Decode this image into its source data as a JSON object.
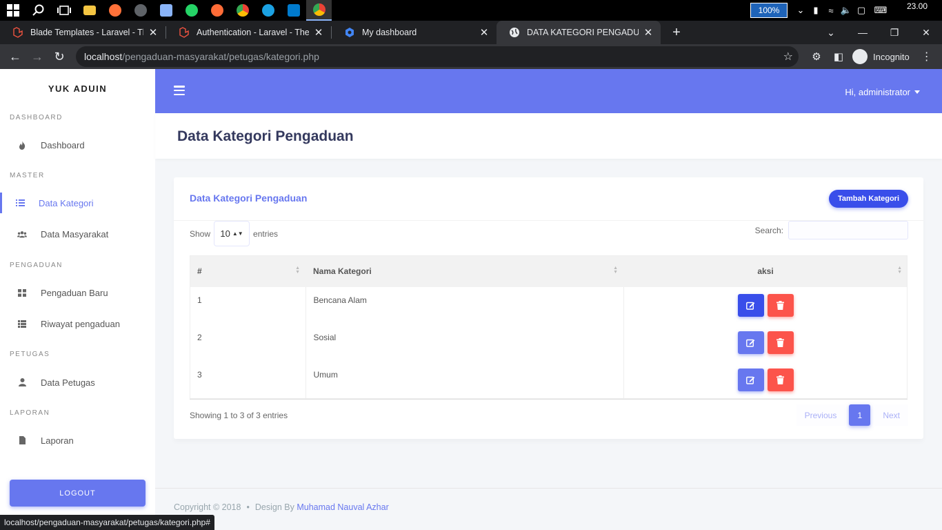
{
  "taskbar": {
    "apps": [
      {
        "icon": "windows-start-icon",
        "color": "#ffffff"
      },
      {
        "icon": "search-icon",
        "color": "#ffffff"
      },
      {
        "icon": "task-view-icon",
        "color": "#ffffff"
      },
      {
        "icon": "file-explorer-icon",
        "color": "#f4c542"
      },
      {
        "icon": "firefox-icon",
        "color": "#ff7139"
      },
      {
        "icon": "app-icon",
        "color": "#9aa0a6"
      },
      {
        "icon": "app-icon",
        "color": "#8ab4f8"
      },
      {
        "icon": "whatsapp-icon",
        "color": "#25d366"
      },
      {
        "icon": "postman-icon",
        "color": "#ff6c37"
      },
      {
        "icon": "chrome-icon",
        "color": "#fbbc05"
      },
      {
        "icon": "app-icon",
        "color": "#1ba1e2"
      },
      {
        "icon": "vscode-icon",
        "color": "#007acc"
      },
      {
        "icon": "chrome-icon",
        "color": "#ea4335"
      }
    ],
    "zoom": "100%",
    "time": "23.00"
  },
  "browser": {
    "tabs": [
      {
        "title": "Blade Templates - Laravel - The P",
        "favicon_color": "#f05340"
      },
      {
        "title": "Authentication - Laravel - The PH",
        "favicon_color": "#f05340"
      },
      {
        "title": "My dashboard",
        "favicon_color": "#4285f4"
      },
      {
        "title": "DATA KATEGORI PENGADUAN",
        "favicon_color": "#e8eaed"
      }
    ],
    "url_host": "localhost",
    "url_path": "/pengaduan-masyarakat/petugas/kategori.php",
    "profile": "Incognito",
    "status_url": "localhost/pengaduan-masyarakat/petugas/kategori.php#"
  },
  "sidebar": {
    "brand": "YUK ADUIN",
    "sections": [
      "DASHBOARD",
      "MASTER",
      "PENGADUAN",
      "PETUGAS",
      "LAPORAN"
    ],
    "items": [
      {
        "label": "Dashboard",
        "icon": "fire-icon"
      },
      {
        "label": "Data Kategori",
        "icon": "list-icon"
      },
      {
        "label": "Data Masyarakat",
        "icon": "users-icon"
      },
      {
        "label": "Pengaduan Baru",
        "icon": "grid-icon"
      },
      {
        "label": "Riwayat pengaduan",
        "icon": "table-list-icon"
      },
      {
        "label": "Data Petugas",
        "icon": "user-icon"
      },
      {
        "label": "Laporan",
        "icon": "file-icon"
      }
    ],
    "logout": "LOGOUT"
  },
  "header": {
    "user": "Hi, administrator"
  },
  "page": {
    "title": "Data Kategori Pengaduan"
  },
  "card": {
    "title": "Data Kategori Pengaduan",
    "add_button": "Tambah Kategori",
    "show_label": "Show",
    "page_length": "10",
    "entries_label": "entries",
    "search_label": "Search:",
    "columns": [
      "#",
      "Nama Kategori",
      "aksi"
    ],
    "rows": [
      {
        "no": "1",
        "name": "Bencana Alam"
      },
      {
        "no": "2",
        "name": "Sosial"
      },
      {
        "no": "3",
        "name": "Umum"
      }
    ],
    "info": "Showing 1 to 3 of 3 entries",
    "pager": {
      "prev": "Previous",
      "current": "1",
      "next": "Next"
    }
  },
  "footer": {
    "copyright": "Copyright © 2018",
    "design_by": "Design By",
    "author": "Muhamad Nauval Azhar"
  },
  "colors": {
    "primary": "#6777ef",
    "primary_dark": "#394eea",
    "danger": "#fc544b"
  }
}
